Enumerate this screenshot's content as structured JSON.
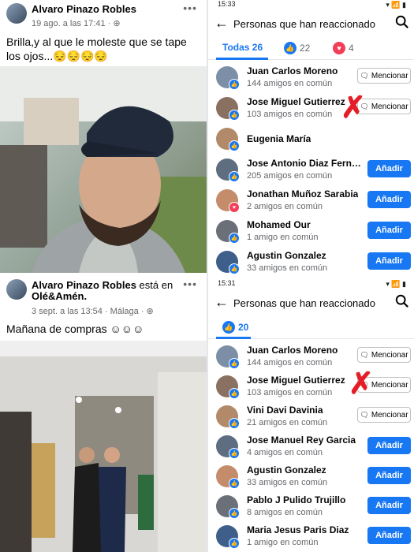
{
  "post1": {
    "author": "Alvaro Pinazo Robles",
    "time": "19 ago. a las 17:41 · ",
    "text": "Brilla,y al que le moleste que se tape los ojos...😔😔😔😔",
    "menu": "•••"
  },
  "post2": {
    "author": "Alvaro Pinazo Robles",
    "verb": " está en",
    "place": "Olé&Amén.",
    "time": "3 sept. a las 13:54 · Málaga · ",
    "text": "Mañana de compras ☺☺☺",
    "menu": "•••"
  },
  "screen1": {
    "status_time": "15:33",
    "status_right": "▾ 📶 ▮",
    "title": "Personas que han reaccionado",
    "tabs": [
      {
        "label": "Todas 26"
      },
      {
        "label": "22"
      },
      {
        "label": "4"
      }
    ],
    "rows": [
      {
        "name": "Juan Carlos Moreno",
        "mutual": "144 amigos en común",
        "button": "Mencionar"
      },
      {
        "name": "Jose Miguel Gutierrez",
        "mutual": "103 amigos en común",
        "button": "Mencionar"
      },
      {
        "name": "Eugenia María",
        "mutual": "",
        "button": ""
      },
      {
        "name": "Jose Antonio Diaz Fernán...",
        "mutual": "205 amigos en común",
        "button": "Añadir"
      },
      {
        "name": "Jonathan Muñoz Sarabia",
        "mutual": "2 amigos en común",
        "button": "Añadir"
      },
      {
        "name": "Mohamed Our",
        "mutual": "1 amigo en común",
        "button": "Añadir"
      },
      {
        "name": "Agustin Gonzalez",
        "mutual": "33 amigos en común",
        "button": "Añadir"
      }
    ]
  },
  "screen2": {
    "status_time": "15:31",
    "status_right": "▾ 📶 ▮",
    "title": "Personas que han reaccionado",
    "tabs": [
      {
        "label": "20"
      }
    ],
    "rows": [
      {
        "name": "Juan Carlos Moreno",
        "mutual": "144 amigos en común",
        "button": "Mencionar"
      },
      {
        "name": "Jose Miguel Gutierrez",
        "mutual": "103 amigos en común",
        "button": "Mencionar"
      },
      {
        "name": "Vini Davi Davinia",
        "mutual": "21 amigos en común",
        "button": "Mencionar"
      },
      {
        "name": "Jose Manuel Rey Garcia",
        "mutual": "4 amigos en común",
        "button": "Añadir"
      },
      {
        "name": "Agustin Gonzalez",
        "mutual": "33 amigos en común",
        "button": "Añadir"
      },
      {
        "name": "Pablo J Pulido Trujillo",
        "mutual": "8 amigos en común",
        "button": "Añadir"
      },
      {
        "name": "Maria Jesus Paris Diaz",
        "mutual": "1 amigo en común",
        "button": "Añadir"
      }
    ]
  },
  "colors": {
    "accent": "#1877f2",
    "love": "#f33e58",
    "mark": "#e41e26"
  },
  "icons": {
    "like": "thumbs-up-icon",
    "love": "heart-icon",
    "back": "arrow-left-icon",
    "search": "search-icon",
    "mention": "speech-bubble-icon"
  }
}
